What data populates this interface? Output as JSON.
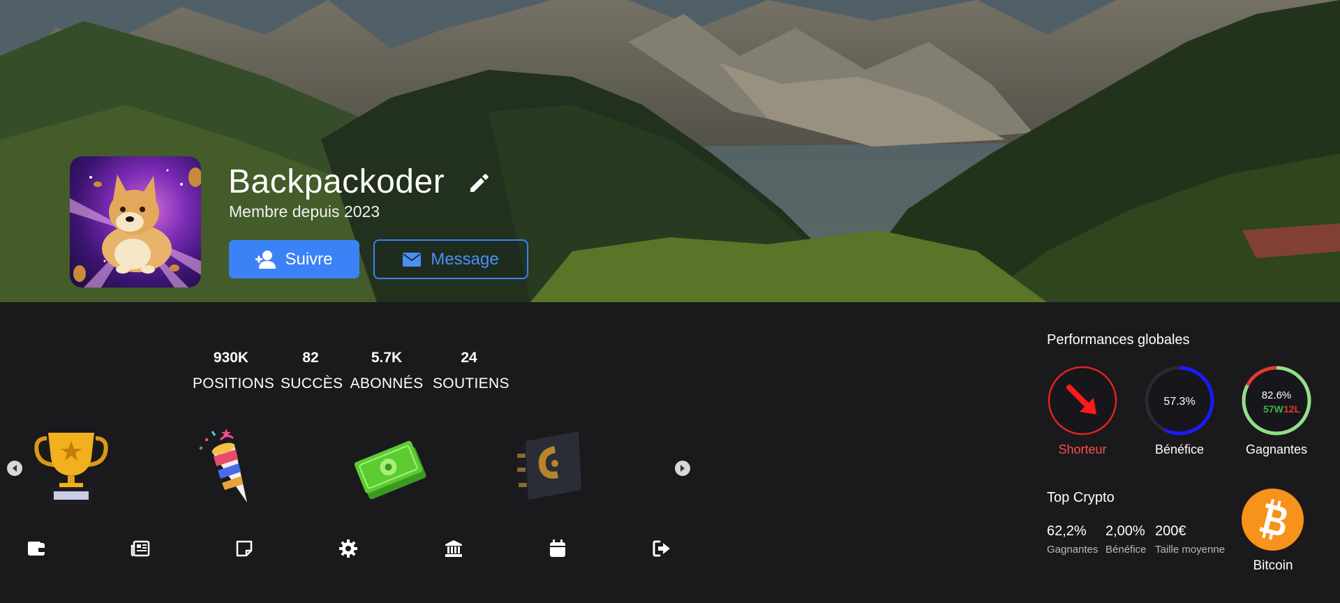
{
  "profile": {
    "username": "Backpackoder",
    "member_since": "Membre depuis 2023",
    "follow_label": "Suivre",
    "message_label": "Message"
  },
  "stats": [
    {
      "value": "930K",
      "label": "POSITIONS"
    },
    {
      "value": "82",
      "label": "SUCCÈS"
    },
    {
      "value": "5.7K",
      "label": "ABONNÉS"
    },
    {
      "value": "24",
      "label": "SOUTIENS"
    }
  ],
  "badges": [
    "trophy-icon",
    "party-popper-icon",
    "money-icon",
    "wallet-book-icon"
  ],
  "bottom_nav": [
    "wallet-icon",
    "newspaper-icon",
    "note-icon",
    "gear-icon",
    "bank-icon",
    "calendar-icon",
    "logout-icon"
  ],
  "performance": {
    "title": "Performances globales",
    "shorteur": {
      "label": "Shorteur",
      "color": "#e53935"
    },
    "benefice": {
      "label": "Bénéfice",
      "value": "57.3%",
      "fraction": 0.573,
      "color": "#1a1aff"
    },
    "gagnantes": {
      "label": "Gagnantes",
      "value": "82.6%",
      "wins": "57W",
      "losses": "12L",
      "fraction": 0.826,
      "win_color": "#8fe08a",
      "loss_color": "#e53935"
    }
  },
  "top_crypto": {
    "title": "Top Crypto",
    "metrics": [
      {
        "value": "62,2%",
        "label": "Gagnantes"
      },
      {
        "value": "2,00%",
        "label": "Bénéfice"
      },
      {
        "value": "200€",
        "label": "Taille moyenne"
      }
    ],
    "coin_name": "Bitcoin",
    "coin_color": "#f7931a"
  },
  "accent": "#3b82f6"
}
